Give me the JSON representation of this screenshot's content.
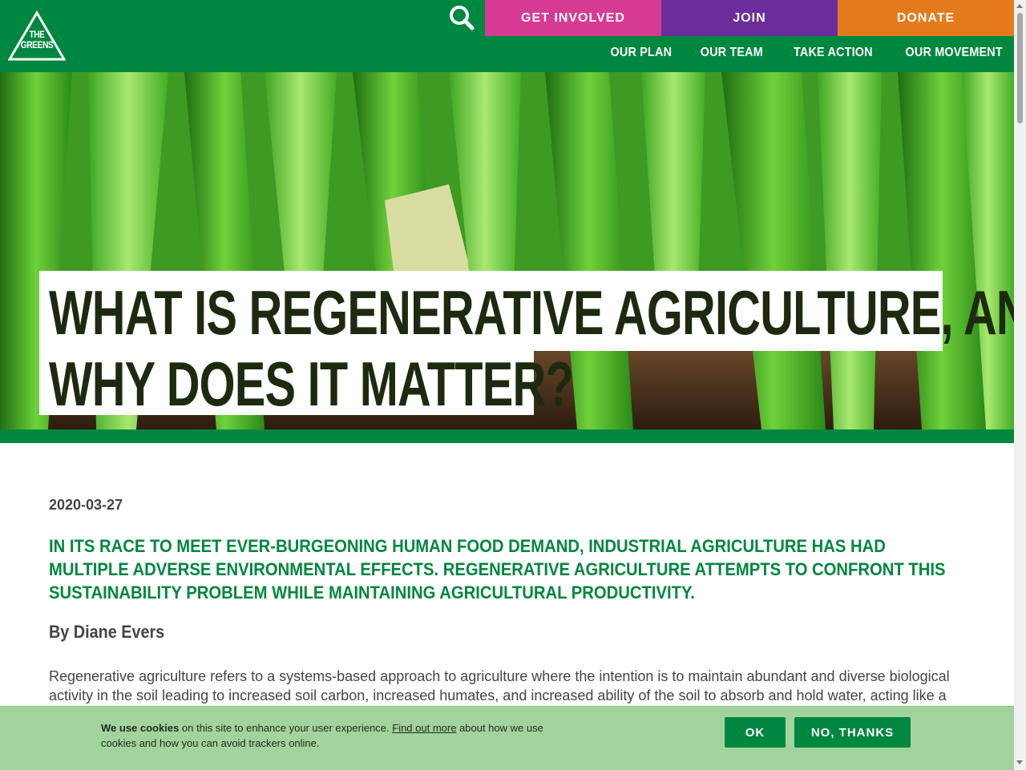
{
  "header": {
    "logo_line1": "THE",
    "logo_line2": "GREENS",
    "search_icon": "search-icon",
    "buttons": [
      {
        "label": "GET INVOLVED",
        "color": "#d63a93"
      },
      {
        "label": "JOIN",
        "color": "#6b2d9b"
      },
      {
        "label": "DONATE",
        "color": "#e57a1c"
      }
    ],
    "nav": [
      "OUR PLAN",
      "OUR TEAM",
      "TAKE ACTION",
      "OUR MOVEMENT"
    ],
    "brand_color": "#00873f"
  },
  "hero": {
    "title_line1": "WHAT IS REGENERATIVE AGRICULTURE, AND",
    "title_line2": "WHY DOES IT MATTER?"
  },
  "article": {
    "date": "2020-03-27",
    "lead": "In its race to meet ever-burgeoning human food demand, industrial agriculture has had multiple adverse environmental effects. Regenerative agriculture attempts to confront this sustainability problem while maintaining agricultural productivity.",
    "author": "By Diane Evers",
    "body": "Regenerative agriculture refers to a systems-based approach to agriculture where the intention is to maintain abundant and diverse biological activity in the soil leading to increased soil carbon, increased humates, and increased ability of the soil to absorb and hold water, acting like a"
  },
  "cookie": {
    "lead_bold": "We use cookies",
    "text1": " on this site to enhance your user experience. ",
    "link": "Find out more",
    "text2": " about how we use cookies and how you can avoid trackers online.",
    "ok_label": "OK",
    "no_label": "NO, THANKS"
  }
}
